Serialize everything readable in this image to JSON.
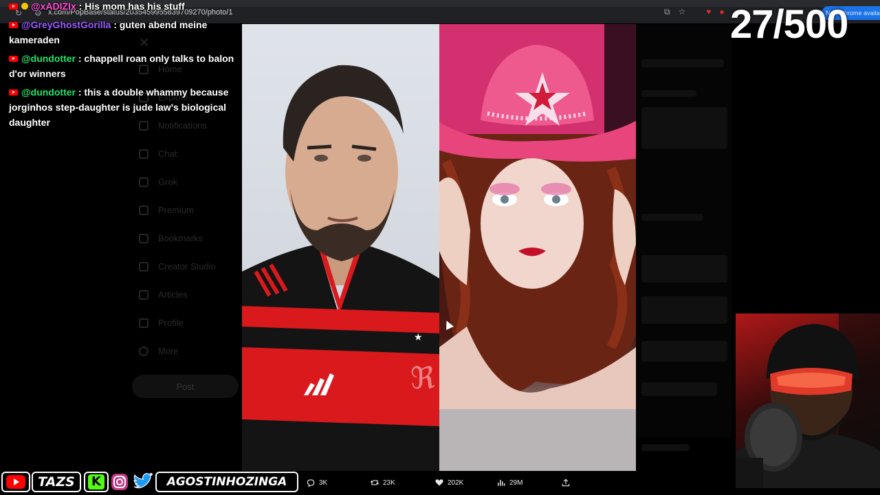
{
  "browser": {
    "url": "x.com/PopBase/status/2035459955839709270/photo/1",
    "profile_label": "New Chrome available"
  },
  "x_sidebar": {
    "items": [
      "Home",
      "Explore",
      "Notifications",
      "Chat",
      "Grok",
      "Premium",
      "Bookmarks",
      "Creator Studio",
      "Articles",
      "Profile",
      "More"
    ],
    "post_label": "Post"
  },
  "chat": {
    "messages": [
      {
        "user": "@xADIZIx",
        "text": ": His mom has his stuff",
        "color": "#ff4fd8"
      },
      {
        "user": "@GreyGhostGorilla",
        "text": ": guten abend meine kameraden",
        "color": "#9b5cff"
      },
      {
        "user": "@dundotter",
        "text": ": chappell roan only talks to balon d'or winners",
        "color": "#26e26a"
      },
      {
        "user": "@dundotter",
        "text": ": this a double whammy because jorginhos step-daughter is jude law's biological daughter",
        "color": "#26e26a"
      }
    ]
  },
  "counter": "27/500",
  "tweet_actions": {
    "replies": "3K",
    "reposts": "23K",
    "likes": "202K",
    "views": "29M"
  },
  "banner": {
    "channel_name": "TAZS",
    "handle": "AGOSTINHOZINGA",
    "kick_letter": "K"
  },
  "colors": {
    "youtube_red": "#ff0000",
    "kick_green": "#53fc18",
    "twitter_blue": "#1d9bf0",
    "flamengo_red": "#d9191c",
    "cowboy_hat_pink": "#e8457c"
  }
}
